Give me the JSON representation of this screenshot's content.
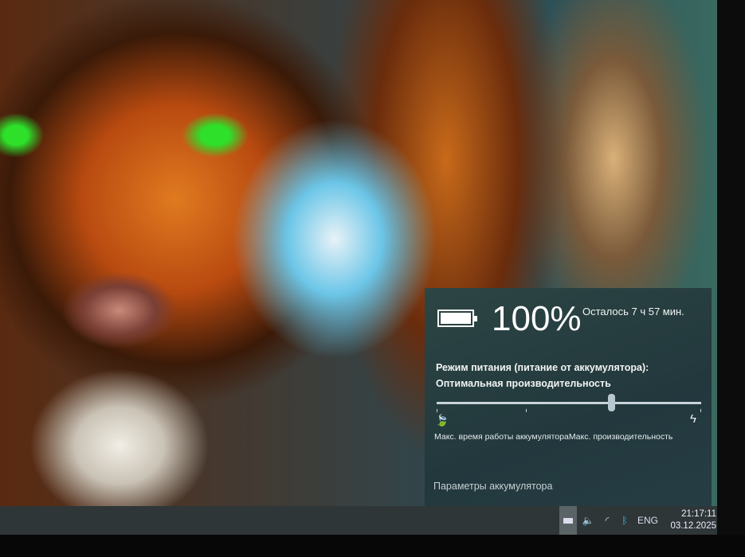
{
  "battery_flyout": {
    "percent_text": "100%",
    "percent": 100,
    "remaining": "Осталось 7 ч 57 мин.",
    "mode_title": "Режим питания (питание от аккумулятора):",
    "mode_value": "Оптимальная производительность",
    "slider_fraction": 0.66,
    "left_label": "Макс. время работы аккумулятора",
    "right_label": "Макс. производительность",
    "settings_link": "Параметры аккумулятора"
  },
  "taskbar": {
    "language": "ENG",
    "time": "21:17:11",
    "date": "03.12.2025",
    "icons": [
      "battery-icon",
      "volume-icon",
      "wifi-icon",
      "bluetooth-icon"
    ]
  }
}
